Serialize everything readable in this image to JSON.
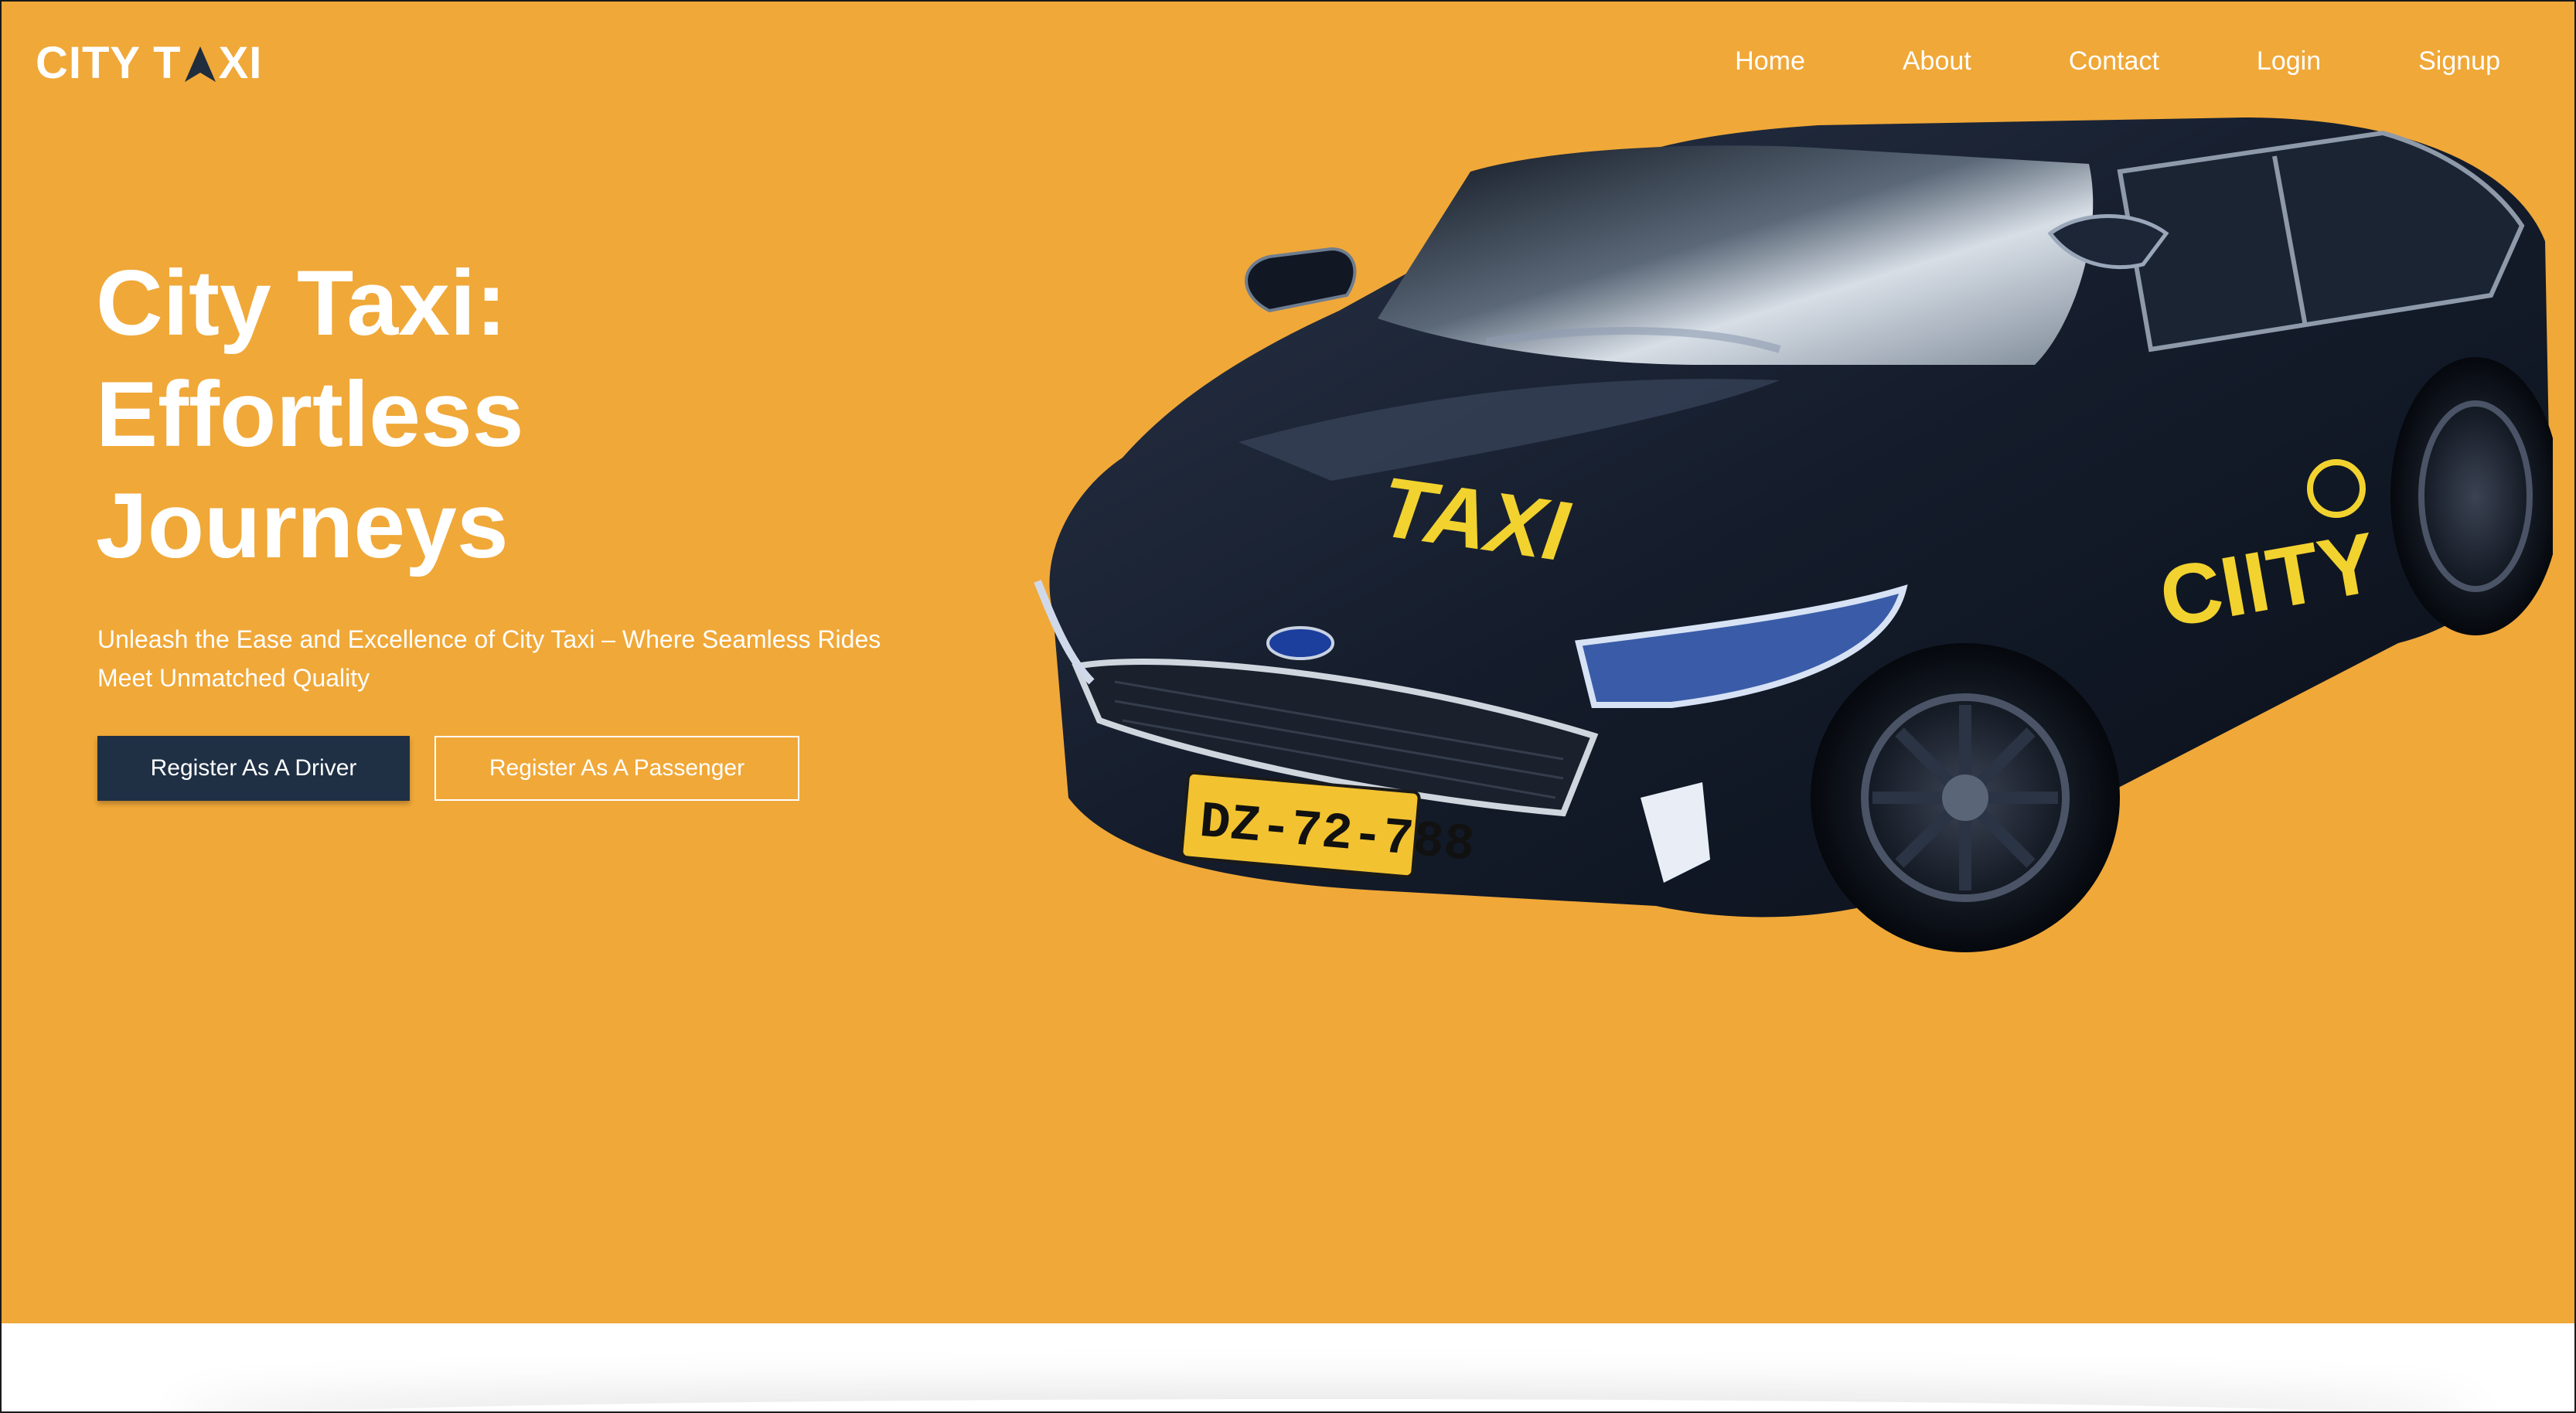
{
  "brand": {
    "logo_before": "CITY T",
    "logo_after": "XI"
  },
  "nav": {
    "items": [
      {
        "label": "Home"
      },
      {
        "label": "About"
      },
      {
        "label": "Contact"
      },
      {
        "label": "Login"
      },
      {
        "label": "Signup"
      }
    ]
  },
  "hero": {
    "title_lines": [
      "City Taxi:",
      "Effortless",
      "Journeys"
    ],
    "subtitle": "Unleash the Ease and Excellence of City Taxi – Where Seamless Rides Meet Unmatched Quality",
    "driver_button": "Register As A Driver",
    "passenger_button": "Register As A Passenger"
  },
  "car_image": {
    "hood_text": "TAXI",
    "door_text": "CIITY",
    "plate": "DZ-72-788"
  },
  "colors": {
    "hero_background": "#f0a838",
    "driver_button": "#1f3045",
    "text": "#ffffff",
    "car_body": "#141c2b",
    "taxi_yellow": "#f2d22e"
  },
  "icons": {
    "logo_arrow": "navigation-arrow-icon"
  }
}
